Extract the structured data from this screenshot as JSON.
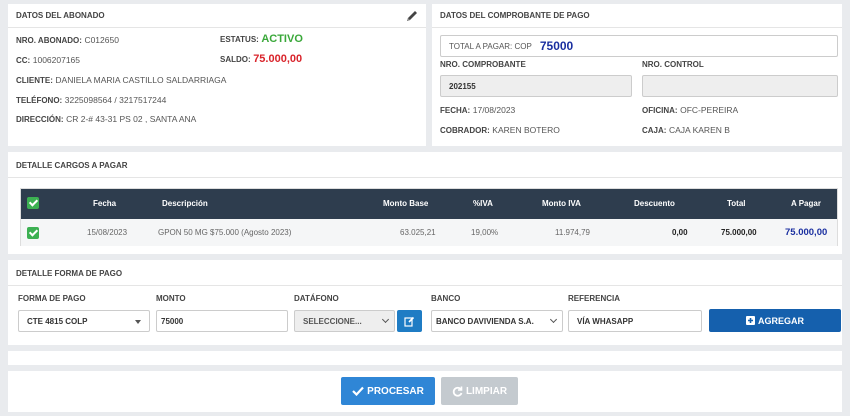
{
  "abonado": {
    "title": "DATOS DEL ABONADO",
    "nro_label": "NRO. ABONADO:",
    "nro_value": "C012650",
    "estatus_label": "ESTATUS:",
    "estatus_value": "ACTIVO",
    "cc_label": "CC:",
    "cc_value": "1006207165",
    "saldo_label": "SALDO:",
    "saldo_value": "75.000,00",
    "cliente_label": "CLIENTE:",
    "cliente_value": "DANIELA MARIA CASTILLO SALDARRIAGA",
    "telefono_label": "TELÉFONO:",
    "telefono_value": "3225098564 / 3217517244",
    "direccion_label": "DIRECCIÓN:",
    "direccion_value": "CR 2-# 43-31 PS 02 , SANTA ANA"
  },
  "comprobante": {
    "title": "DATOS DEL COMPROBANTE DE PAGO",
    "total_label": "TOTAL A PAGAR: COP",
    "total_value": "75000",
    "nro_comprobante_label": "NRO. COMPROBANTE",
    "nro_comprobante_value": "202155",
    "nro_control_label": "NRO. CONTROL",
    "nro_control_value": "",
    "fecha_label": "FECHA:",
    "fecha_value": "17/08/2023",
    "oficina_label": "OFICINA:",
    "oficina_value": "OFC-PEREIRA",
    "cobrador_label": "COBRADOR:",
    "cobrador_value": "KAREN BOTERO",
    "caja_label": "CAJA:",
    "caja_value": "CAJA KAREN B"
  },
  "cargos": {
    "title": "DETALLE CARGOS A PAGAR",
    "headers": {
      "fecha": "Fecha",
      "descripcion": "Descripción",
      "monto_base": "Monto Base",
      "iva": "%IVA",
      "monto_iva": "Monto IVA",
      "descuento": "Descuento",
      "total": "Total",
      "a_pagar": "A Pagar"
    },
    "rows": [
      {
        "fecha": "15/08/2023",
        "descripcion": "GPON 50 MG $75.000 (Agosto 2023)",
        "monto_base": "63.025,21",
        "iva": "19,00%",
        "monto_iva": "11.974,79",
        "descuento": "0,00",
        "total": "75.000,00",
        "a_pagar": "75.000,00"
      }
    ]
  },
  "forma_pago": {
    "title": "DETALLE FORMA DE PAGO",
    "forma_label": "FORMA DE PAGO",
    "forma_value": "CTE 4815 COLP",
    "monto_label": "MONTO",
    "monto_value": "75000",
    "datafono_label": "DATÁFONO",
    "datafono_value": "SELECCIONE...",
    "banco_label": "BANCO",
    "banco_value": "BANCO DAVIVIENDA S.A.",
    "referencia_label": "REFERENCIA",
    "referencia_value": "VÍA WHASAPP",
    "agregar_label": "AGREGAR"
  },
  "actions": {
    "procesar_label": "PROCESAR",
    "limpiar_label": "LIMPIAR"
  },
  "colors": {
    "active": "#3aa83a",
    "saldo": "#d9242b",
    "total_blue": "#1a2fa0",
    "table_header": "#2e3d4e",
    "primary_button": "#1560ad",
    "process_button": "#2f86d6",
    "clear_button": "#c4cacf"
  },
  "icons": [
    "pencil-icon",
    "checkbox-checked-icon",
    "edit-icon",
    "plus-square-icon",
    "check-icon",
    "refresh-icon",
    "chevron-down-icon"
  ]
}
